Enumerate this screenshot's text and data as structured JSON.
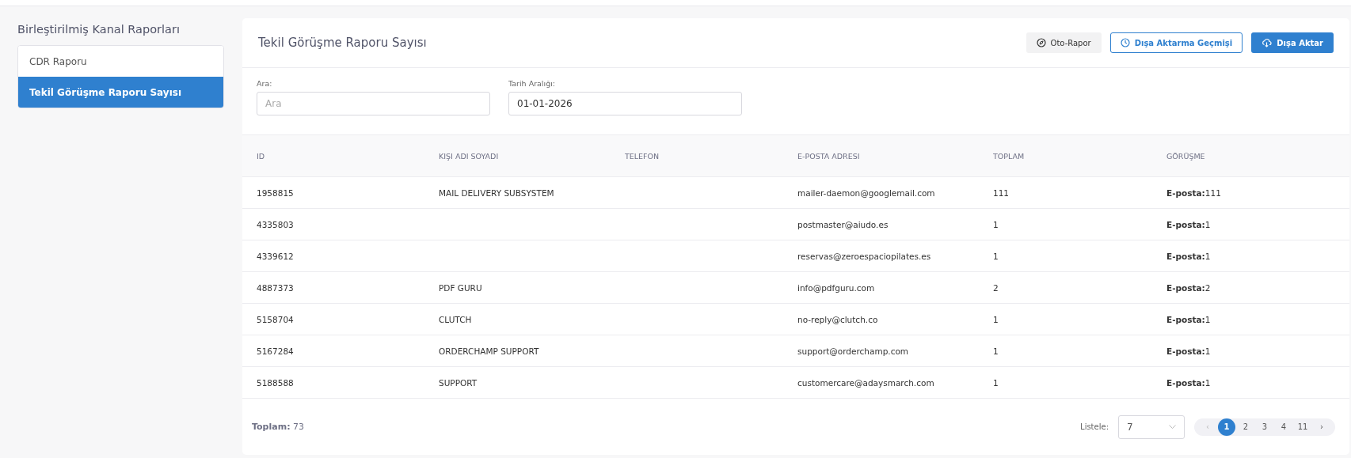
{
  "sidebar": {
    "title": "Birleştirilmiş Kanal Raporları",
    "items": [
      {
        "label": "CDR Raporu",
        "selected": false
      },
      {
        "label": "Tekil Görüşme Raporu Sayısı",
        "selected": true
      }
    ]
  },
  "panel": {
    "title": "Tekil Görüşme Raporu Sayısı",
    "buttons": [
      {
        "kind": "auto",
        "label": "Oto-Rapor"
      },
      {
        "kind": "history",
        "label": "Dışa Aktarma Geçmişi"
      },
      {
        "kind": "export",
        "label": "Dışa Aktar"
      }
    ],
    "filters": [
      {
        "label": "Ara:",
        "placeholder": "Ara"
      },
      {
        "label": "Tarih Aralığı:",
        "value": "01-01-2026"
      }
    ],
    "table": {
      "columns": [
        "ID",
        "KIŞI ADI SOYADI",
        "TELEFON",
        "E-POSTA ADRESI",
        "TOPLAM",
        "GÖRÜŞME"
      ],
      "rows": [
        [
          "1958815",
          "MAIL DELIVERY SUBSYSTEM",
          "",
          "mailer-daemon@googlemail.com",
          "111",
          "**E-posta:**111"
        ],
        [
          "4335803",
          "",
          "",
          "postmaster@aiudo.es",
          "1",
          "**E-posta:**1"
        ],
        [
          "4339612",
          "",
          "",
          "reservas@zeroespaciopilates.es",
          "1",
          "**E-posta:**1"
        ],
        [
          "4887373",
          "PDF GURU",
          "",
          "info@pdfguru.com",
          "2",
          "**E-posta:**2"
        ],
        [
          "5158704",
          "CLUTCH",
          "",
          "no-reply@clutch.co",
          "1",
          "**E-posta:**1"
        ],
        [
          "5167284",
          "ORDERCHAMP SUPPORT",
          "",
          "support@orderchamp.com",
          "1",
          "**E-posta:**1"
        ],
        [
          "5188588",
          "SUPPORT",
          "",
          "customercare@adaysmarch.com",
          "1",
          "**E-posta:**1"
        ]
      ]
    },
    "footer": {
      "total": "**Toplam:** 73",
      "page_size_label": "Listele:",
      "page_size": "7",
      "prev": {
        "label": "‹",
        "disabled": true
      },
      "pages": [
        {
          "label": "1",
          "selected": true
        },
        {
          "label": "2",
          "selected": false
        },
        {
          "label": "3",
          "selected": false
        },
        {
          "label": "4",
          "selected": false
        },
        {
          "label": "11",
          "selected": false
        }
      ],
      "next": {
        "label": "›",
        "disabled": false
      }
    }
  }
}
